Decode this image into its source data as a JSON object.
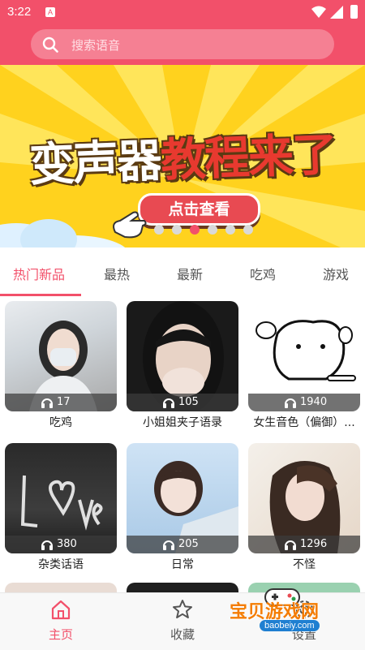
{
  "status_bar": {
    "time": "3:22",
    "notification_icon": "A"
  },
  "search": {
    "placeholder": "搜索语音"
  },
  "banner": {
    "title_part1": "变声器",
    "title_part2": "教程来了",
    "cta": "点击查看",
    "carousel_count": 6,
    "carousel_active_index": 2
  },
  "tabs": [
    {
      "label": "热门新品",
      "active": true
    },
    {
      "label": "最热",
      "active": false
    },
    {
      "label": "最新",
      "active": false
    },
    {
      "label": "吃鸡",
      "active": false
    },
    {
      "label": "游戏",
      "active": false
    }
  ],
  "cards": [
    {
      "title": "吃鸡",
      "plays": "17"
    },
    {
      "title": "小姐姐夹子语录",
      "plays": "105"
    },
    {
      "title": "女生音色（偏御）...",
      "plays": "1940"
    },
    {
      "title": "杂类话语",
      "plays": "380"
    },
    {
      "title": "日常",
      "plays": "205"
    },
    {
      "title": "不怪",
      "plays": "1296"
    }
  ],
  "bottom_nav": [
    {
      "label": "主页",
      "icon": "home-icon",
      "active": true
    },
    {
      "label": "收藏",
      "icon": "star-icon",
      "active": false
    },
    {
      "label": "设置",
      "icon": "gear-icon",
      "active": false
    }
  ],
  "watermark": {
    "name": "宝贝游戏网",
    "url": "baobeiy.com"
  },
  "colors": {
    "brand": "#f2506a",
    "banner_bg": "#ffd21e"
  }
}
